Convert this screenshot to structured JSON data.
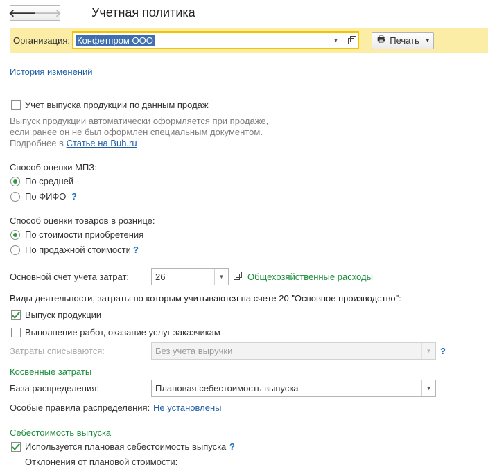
{
  "nav": {
    "back": "🡐",
    "forward": "🡒"
  },
  "title": "Учетная политика",
  "org": {
    "label": "Организация:",
    "value": "Конфетпром ООО",
    "print_label": "Печать"
  },
  "history_link": "История изменений",
  "sales_release": {
    "checkbox_label": "Учет выпуска продукции по данным продаж",
    "checked": false,
    "hint_line1": "Выпуск продукции автоматически оформляется при продаже,",
    "hint_line2": "если ранее он не был оформлен специальным документом.",
    "more_prefix": "Подробнее в",
    "more_link": "Статье на Buh.ru"
  },
  "mpz": {
    "label": "Способ оценки МПЗ:",
    "options": [
      "По средней",
      "По ФИФО"
    ],
    "selected": 0,
    "help": "?"
  },
  "retail": {
    "label": "Способ оценки товаров в рознице:",
    "options": [
      "По стоимости приобретения",
      "По продажной стоимости"
    ],
    "selected": 0,
    "help": "?"
  },
  "cost_account": {
    "label": "Основной счет учета затрат:",
    "value": "26",
    "description": "Общехозяйственные расходы"
  },
  "activities": {
    "label": "Виды деятельности, затраты по которым учитываются на счете 20 \"Основное производство\":",
    "items": [
      {
        "label": "Выпуск продукции",
        "checked": true
      },
      {
        "label": "Выполнение работ, оказание услуг заказчикам",
        "checked": false
      }
    ]
  },
  "writeoff": {
    "label": "Затраты списываются:",
    "value": "Без учета выручки",
    "help": "?"
  },
  "indirect": {
    "heading": "Косвенные затраты",
    "base_label": "База распределения:",
    "base_value": "Плановая себестоимость выпуска",
    "rules_label": "Особые правила распределения:",
    "rules_link": "Не установлены"
  },
  "cost": {
    "heading": "Себестоимость выпуска",
    "planned_label": "Используется плановая себестоимость выпуска",
    "planned_checked": true,
    "help": "?",
    "deviations_label": "Отклонения от плановой стоимости:"
  },
  "colors": {
    "accent_green": "#1a8c3a",
    "link_blue": "#1f5fa8",
    "org_bar": "#fbeca6",
    "focus_border": "#f5c400"
  }
}
